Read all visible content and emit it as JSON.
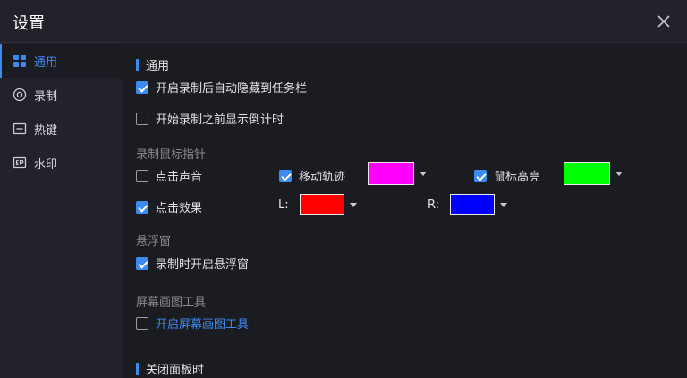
{
  "window": {
    "title": "设置"
  },
  "sidebar": {
    "items": [
      {
        "label": "通用",
        "icon": "grid-icon",
        "active": true
      },
      {
        "label": "录制",
        "icon": "record-icon",
        "active": false
      },
      {
        "label": "热键",
        "icon": "keyboard-icon",
        "active": false
      },
      {
        "label": "水印",
        "icon": "watermark-icon",
        "active": false
      }
    ]
  },
  "general": {
    "title": "通用",
    "auto_hide": {
      "label": "开启录制后自动隐藏到任务栏",
      "checked": true
    },
    "countdown": {
      "label": "开始录制之前显示倒计时",
      "checked": false
    }
  },
  "cursor": {
    "title": "录制鼠标指针",
    "click_sound": {
      "label": "点击声音",
      "checked": false
    },
    "move_track": {
      "label": "移动轨迹",
      "checked": true,
      "color": "#ff00ff"
    },
    "highlight": {
      "label": "鼠标高亮",
      "checked": true,
      "color": "#00ff00"
    },
    "click_effect": {
      "label": "点击效果",
      "checked": true
    },
    "left_label": "L:",
    "left_color": "#ff0000",
    "right_label": "R:",
    "right_color": "#0000ff"
  },
  "floating": {
    "title": "悬浮窗",
    "enable": {
      "label": "录制时开启悬浮窗",
      "checked": true
    }
  },
  "drawing": {
    "title": "屏幕画图工具",
    "enable": {
      "label": "开启屏幕画图工具",
      "checked": false
    }
  },
  "close_panel": {
    "title": "关闭面板时"
  }
}
